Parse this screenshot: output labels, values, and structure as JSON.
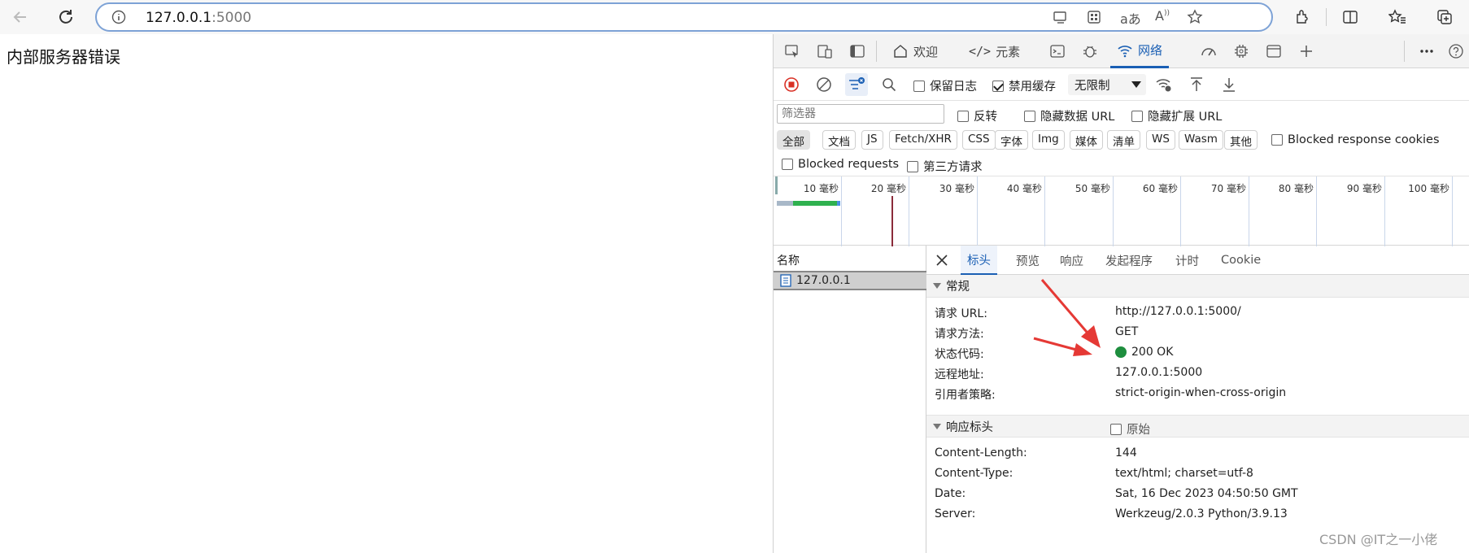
{
  "browser": {
    "url_host": "127.0.0.1",
    "url_port": ":5000"
  },
  "page": {
    "message": "内部服务器错误"
  },
  "devtools": {
    "tabs": [
      {
        "label": "欢迎"
      },
      {
        "label": "元素"
      },
      {
        "label": "网络"
      }
    ],
    "toolbar": {
      "preserve_log": "保留日志",
      "disable_cache": "禁用缓存",
      "throttle": "无限制"
    },
    "filter": {
      "placeholder": "筛选器",
      "invert": "反转",
      "hide_data_urls": "隐藏数据 URL",
      "hide_ext_urls": "隐藏扩展 URL"
    },
    "types": [
      "全部",
      "文档",
      "JS",
      "Fetch/XHR",
      "CSS",
      "字体",
      "Img",
      "媒体",
      "清单",
      "WS",
      "Wasm",
      "其他"
    ],
    "blocked_response_cookies": "Blocked response cookies",
    "blocked_requests": "Blocked requests",
    "third_party": "第三方请求",
    "timeline_ticks": [
      "10 毫秒",
      "20 毫秒",
      "30 毫秒",
      "40 毫秒",
      "50 毫秒",
      "60 毫秒",
      "70 毫秒",
      "80 毫秒",
      "90 毫秒",
      "100 毫秒"
    ],
    "name_header": "名称",
    "request_name": "127.0.0.1",
    "detail_tabs": [
      "标头",
      "预览",
      "响应",
      "发起程序",
      "计时",
      "Cookie"
    ],
    "general": {
      "title": "常规",
      "rows": [
        {
          "k": "请求 URL:",
          "v": "http://127.0.0.1:5000/"
        },
        {
          "k": "请求方法:",
          "v": "GET"
        },
        {
          "k": "状态代码:",
          "v": "200 OK"
        },
        {
          "k": "远程地址:",
          "v": "127.0.0.1:5000"
        },
        {
          "k": "引用者策略:",
          "v": "strict-origin-when-cross-origin"
        }
      ]
    },
    "response_headers": {
      "title": "响应标头",
      "raw": "原始",
      "rows": [
        {
          "k": "Content-Length:",
          "v": "144"
        },
        {
          "k": "Content-Type:",
          "v": "text/html; charset=utf-8"
        },
        {
          "k": "Date:",
          "v": "Sat, 16 Dec 2023 04:50:50 GMT"
        },
        {
          "k": "Server:",
          "v": "Werkzeug/2.0.3 Python/3.9.13"
        }
      ]
    }
  },
  "watermark": "CSDN @IT之一小佬",
  "colors": {
    "accent": "#1a5fb4",
    "status_ok": "#1e8e3e",
    "annotation": "#e53935"
  }
}
